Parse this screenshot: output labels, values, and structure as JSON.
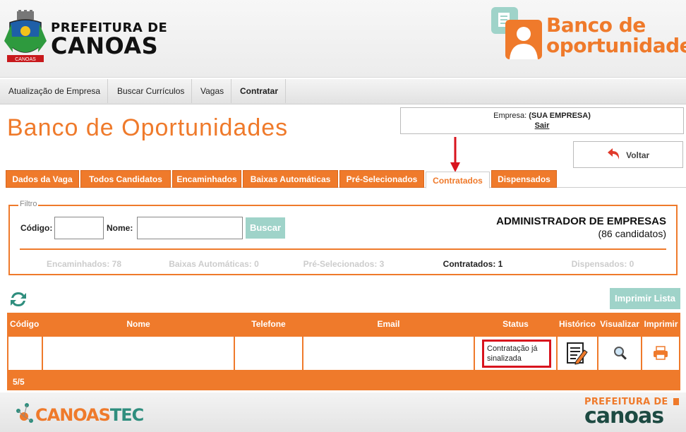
{
  "header": {
    "pref_line1": "PREFEITURA DE",
    "pref_line2": "CANOAS",
    "crest_banner": "CANOAS",
    "banco_line1": "Banco de",
    "banco_line2": "oportunidades"
  },
  "nav": {
    "items": [
      "Atualização de Empresa",
      "Buscar Currículos",
      "Vagas",
      "Contratar"
    ]
  },
  "page_title": "Banco de Oportunidades",
  "empresa": {
    "label": "Empresa:",
    "name": "(SUA EMPRESA)",
    "sair": "Sair"
  },
  "voltar": "Voltar",
  "tabs": [
    {
      "label": "Dados da Vaga"
    },
    {
      "label": "Todos Candidatos"
    },
    {
      "label": "Encaminhados"
    },
    {
      "label": "Baixas Automáticas"
    },
    {
      "label": "Pré-Selecionados"
    },
    {
      "label": "Contratados",
      "active": true
    },
    {
      "label": "Dispensados"
    }
  ],
  "filtro": {
    "legend": "Filtro",
    "codigo_label": "Código:",
    "nome_label": "Nome:",
    "codigo_value": "",
    "nome_value": "",
    "buscar": "Buscar",
    "admin_title": "ADMINISTRADOR DE EMPRESAS",
    "admin_count": "(86 candidatos)",
    "counts": {
      "encaminhados": "Encaminhados: 78",
      "baixas": "Baixas Automáticas: 0",
      "preselecionados": "Pré-Selecionados: 3",
      "contratados": "Contratados: 1",
      "dispensados": "Dispensados: 0"
    }
  },
  "print_list": "Imprimir Lista",
  "table": {
    "headers": {
      "codigo": "Código",
      "nome": "Nome",
      "telefone": "Telefone",
      "email": "Email",
      "status": "Status",
      "historico": "Histórico",
      "visualizar": "Visualizar",
      "imprimir": "Imprimir"
    },
    "row": {
      "codigo": "",
      "nome": "",
      "telefone": "",
      "email": "",
      "status": "Contratação já sinalizada"
    },
    "footer": "5/5"
  },
  "footer": {
    "canoastec_a": "CANOAS",
    "canoastec_b": "TEC",
    "pref_line1": "PREFEITURA DE",
    "pref_line2": "canoas"
  },
  "colors": {
    "orange": "#ef7a2b",
    "teal": "#9fd3c9",
    "red": "#d8141e"
  }
}
